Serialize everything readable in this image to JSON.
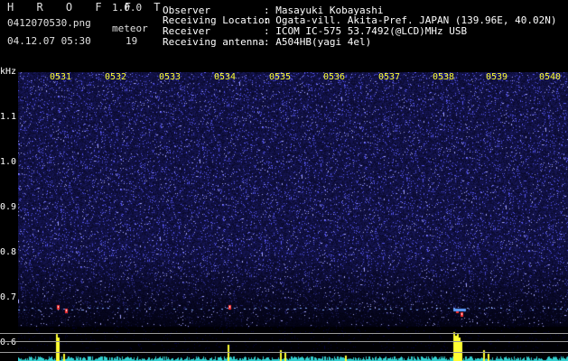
{
  "app": {
    "name": "H R O F F T",
    "version": "1.0.0",
    "filename": "0412070530.png",
    "datetime": "04.12.07 05:30",
    "meteor_label": "meteor",
    "meteor_count": "19"
  },
  "info": {
    "rows": [
      {
        "label": "Observer",
        "value": ": Masayuki Kobayashi"
      },
      {
        "label": "Receiving Location",
        "value": ": Ogata-vill. Akita-Pref. JAPAN (139.96E, 40.02N)"
      },
      {
        "label": "Receiver",
        "value": ": ICOM IC-575 53.7492(@LCD)MHz USB"
      },
      {
        "label": "Receiving antenna",
        "value": ": A504HB(yagi 4el)"
      }
    ]
  },
  "spectrogram": {
    "y_unit": "kHz",
    "y_ticks": [
      "1.1",
      "1.0",
      "0.9",
      "0.8",
      "0.7",
      "0.6"
    ],
    "x_ticks": [
      "0531",
      "0532",
      "0533",
      "0534",
      "0535",
      "0536",
      "0537",
      "0538",
      "0539",
      "0540"
    ],
    "colors": {
      "background": "#000000",
      "noise_floor": "#1a1a70",
      "speckle": "#6a6aff",
      "tick_label": "#ffff33",
      "power_trace": "#33d0d0",
      "power_peak": "#ffff33",
      "echo": "#ff4040"
    }
  }
}
